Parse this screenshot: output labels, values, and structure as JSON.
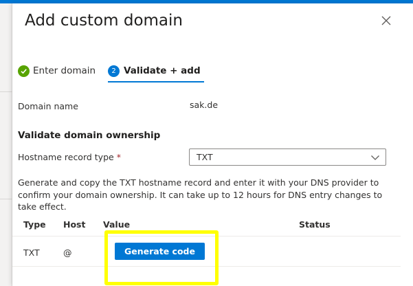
{
  "colors": {
    "accent": "#0078d4",
    "success": "#57a300",
    "required": "#a4262c",
    "highlight": "#ffff00"
  },
  "panel": {
    "title": "Add custom domain",
    "close_icon": "close-icon"
  },
  "steps": [
    {
      "label": "Enter domain",
      "state": "completed",
      "icon": "checkmark-icon"
    },
    {
      "number": "2",
      "label": "Validate + add",
      "state": "active"
    }
  ],
  "domain": {
    "label": "Domain name",
    "value": "sak.de"
  },
  "validation": {
    "heading": "Validate domain ownership",
    "record_type_label": "Hostname record type",
    "required_marker": "*",
    "record_type_value": "TXT",
    "description": "Generate and copy the TXT hostname record and enter it with your DNS provider to confirm your domain ownership. It can take up to 12 hours for DNS entry changes to take effect."
  },
  "table": {
    "headers": [
      "Type",
      "Host",
      "Value",
      "Status"
    ],
    "rows": [
      {
        "type": "TXT",
        "host": "@",
        "action": "Generate code",
        "status": ""
      }
    ]
  }
}
